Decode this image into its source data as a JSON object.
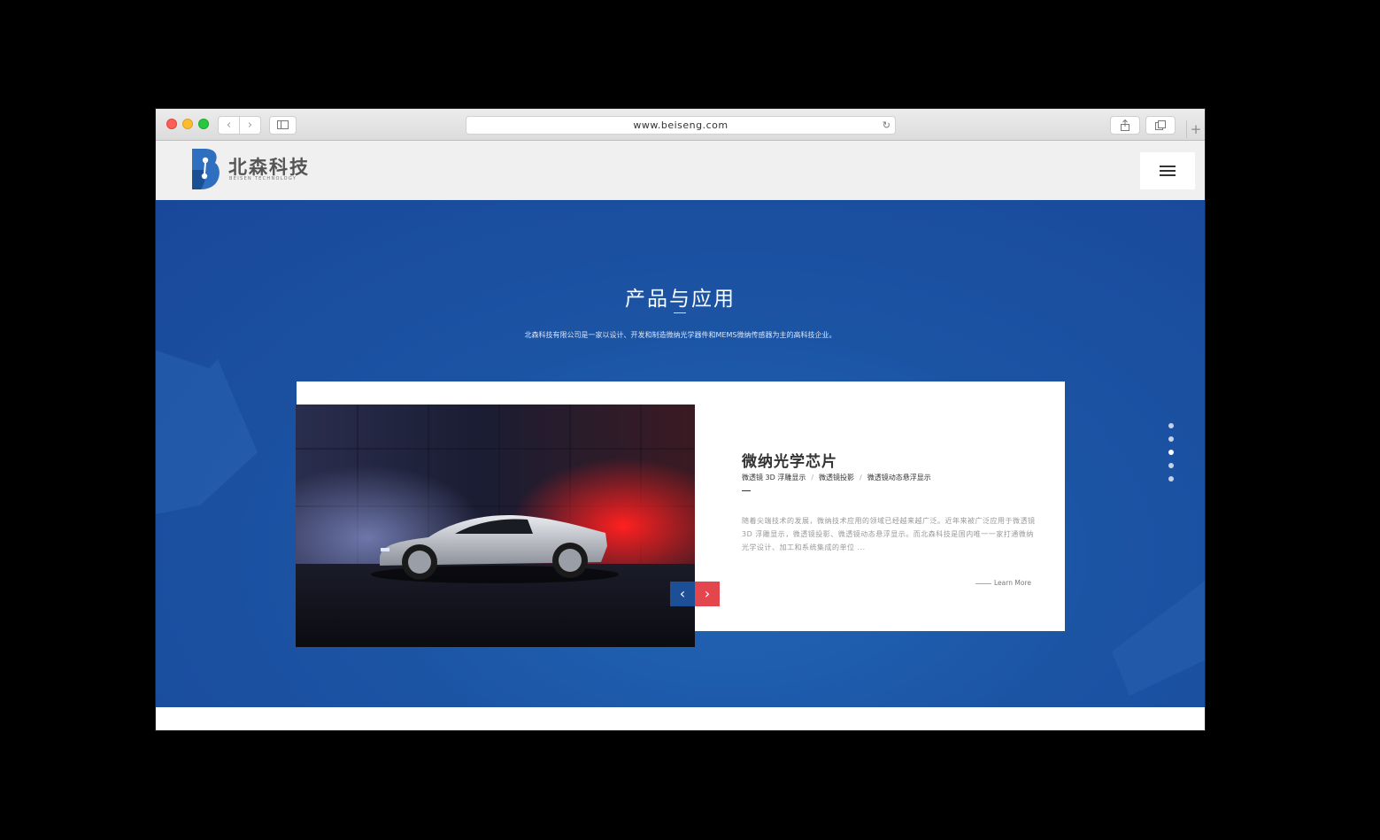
{
  "browser": {
    "url": "www.beiseng.com",
    "back_icon": "‹",
    "forward_icon": "›",
    "reload_icon": "↻",
    "new_tab_icon": "+"
  },
  "header": {
    "logo_cn": "北森科技",
    "logo_en": "BEISEN TECHNOLOGY",
    "logo_color": "#2f6fbf"
  },
  "section": {
    "title": "产品与应用",
    "description": "北森科技有限公司是一家以设计、开发和制造微纳光学器件和MEMS微纳传感器为主的高科技企业。"
  },
  "product": {
    "title": "微纳光学芯片",
    "tags": [
      "微透镜 3D 浮雕显示",
      "微透镜投影",
      "微透镜动态悬浮显示"
    ],
    "tag_separator": "/",
    "description": "随着尖端技术的发展，微纳技术应用的领域已经越来越广泛。近年来被广泛应用于微透镜 3D 浮雕显示，微透镜投影、微透镜动态悬浮显示。而北森科技是国内唯一一家打通微纳光学设计、加工和系统集成的单位 ...",
    "learn_more": "Learn More"
  },
  "carousel": {
    "prev_icon": "‹",
    "next_icon": "›",
    "prev_color": "#1c4f95",
    "next_color": "#e3464d",
    "slides": 5,
    "active_slide": 3
  },
  "colors": {
    "hero_blue": "#1c54a4",
    "accent_red": "#e3464d"
  }
}
